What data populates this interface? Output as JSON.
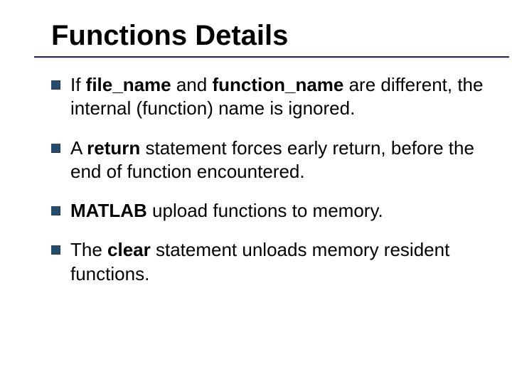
{
  "title": "Functions Details",
  "bullets": [
    {
      "t0": "If ",
      "b0": "file_name",
      "t1": " and ",
      "b1": "function_name",
      "t2": " are different, the internal (function) name is ignored."
    },
    {
      "t0": "A ",
      "b0": "return",
      "t1": " statement forces early return, before the end of function encountered.",
      "b1": "",
      "t2": ""
    },
    {
      "t0": "",
      "b0": "MATLAB",
      "t1": " upload functions to memory.",
      "b1": "",
      "t2": ""
    },
    {
      "t0": "The ",
      "b0": "clear",
      "t1": " statement unloads memory resident functions.",
      "b1": "",
      "t2": ""
    }
  ]
}
